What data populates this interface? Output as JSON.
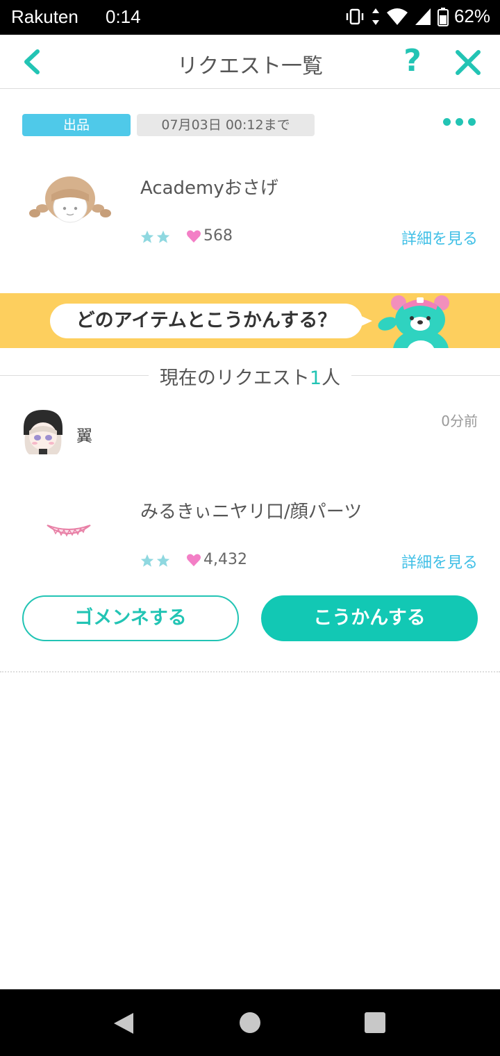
{
  "status_bar": {
    "carrier": "Rakuten",
    "time": "0:14",
    "battery": "62%"
  },
  "header": {
    "title": "リクエスト一覧",
    "help": "?"
  },
  "listing": {
    "tag": "出品",
    "deadline": "07月03日 00:12まで",
    "item": {
      "name": "Academyおさげ",
      "rarity_stars": 2,
      "likes": "568",
      "detail_link": "詳細を見る"
    }
  },
  "banner": {
    "prompt": "どのアイテムとこうかんする？"
  },
  "requests_section": {
    "label_prefix": "現在のリクエスト",
    "count": "1",
    "label_suffix": "人"
  },
  "request": {
    "user_name": "翼",
    "time_ago": "0分前",
    "item": {
      "name": "みるきぃニヤリ口/顔パーツ",
      "rarity_stars": 2,
      "likes": "4,432",
      "detail_link": "詳細を見る"
    }
  },
  "buttons": {
    "decline": "ゴメンネする",
    "accept": "こうかんする"
  },
  "colors": {
    "accent": "#22c4b4",
    "link": "#3fbfe6",
    "tag": "#4fc9e9",
    "banner": "#fdcf5e",
    "heart": "#f37fc6"
  }
}
